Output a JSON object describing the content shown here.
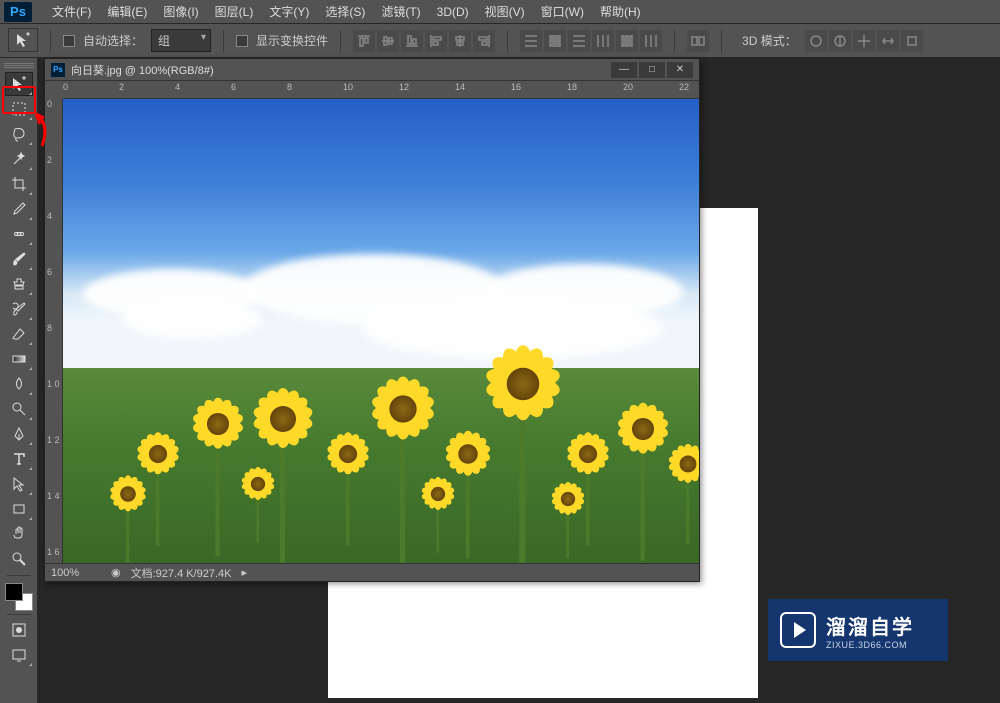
{
  "menubar": {
    "logo": "Ps",
    "items": [
      "文件(F)",
      "编辑(E)",
      "图像(I)",
      "图层(L)",
      "文字(Y)",
      "选择(S)",
      "滤镜(T)",
      "3D(D)",
      "视图(V)",
      "窗口(W)",
      "帮助(H)"
    ]
  },
  "options": {
    "auto_select_label": "自动选择：",
    "auto_select_value": "组",
    "show_transform_label": "显示变换控件",
    "mode_3d_label": "3D 模式："
  },
  "tools": [
    {
      "name": "move-tool",
      "selected": true
    },
    {
      "name": "marquee-tool"
    },
    {
      "name": "lasso-tool"
    },
    {
      "name": "magic-wand-tool"
    },
    {
      "name": "crop-tool"
    },
    {
      "name": "eyedropper-tool"
    },
    {
      "name": "spot-heal-tool"
    },
    {
      "name": "brush-tool"
    },
    {
      "name": "clone-stamp-tool"
    },
    {
      "name": "history-brush-tool"
    },
    {
      "name": "eraser-tool"
    },
    {
      "name": "gradient-tool"
    },
    {
      "name": "blur-tool"
    },
    {
      "name": "dodge-tool"
    },
    {
      "name": "pen-tool"
    },
    {
      "name": "type-tool"
    },
    {
      "name": "path-select-tool"
    },
    {
      "name": "rectangle-tool"
    },
    {
      "name": "hand-tool"
    },
    {
      "name": "zoom-tool"
    }
  ],
  "document": {
    "icon": "Ps",
    "title": "向日葵.jpg @ 100%(RGB/8#)",
    "ruler_h": [
      "0",
      "2",
      "4",
      "6",
      "8",
      "10",
      "12",
      "14",
      "16",
      "18",
      "20",
      "22"
    ],
    "ruler_v": [
      "0",
      "2",
      "4",
      "6",
      "8",
      "1\n0",
      "1\n2",
      "1\n4",
      "1\n6"
    ],
    "status": {
      "zoom": "100%",
      "doc_info": "文档:927.4 K/927.4K"
    }
  },
  "timeline_ruler": [
    "2",
    "4",
    "6",
    "8"
  ],
  "brand": {
    "main": "溜溜自学",
    "sub": "ZIXUE.3D66.COM"
  }
}
